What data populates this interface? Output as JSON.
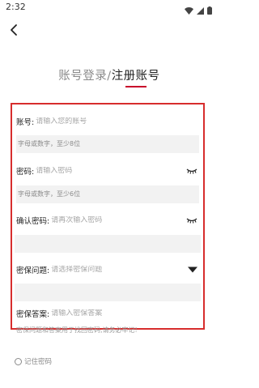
{
  "status": {
    "time": "2:32"
  },
  "nav": {
    "back_icon": "back-arrow-icon"
  },
  "tabs": {
    "login": "账号登录",
    "separator": "/",
    "register": "注册账号"
  },
  "form": {
    "account": {
      "label": "账号:",
      "placeholder": "请输入您的账号",
      "value": "",
      "hint": "字母或数字，至少8位"
    },
    "password": {
      "label": "密码:",
      "placeholder": "请输入密码",
      "value": "",
      "hint": "字母或数字，至少6位",
      "icon": "eye-closed-icon"
    },
    "confirm_password": {
      "label": "确认密码:",
      "placeholder": "请再次输入密码",
      "value": "",
      "icon": "eye-closed-icon"
    },
    "security_question": {
      "label": "密保问题:",
      "placeholder": "请选择密保问题",
      "icon": "dropdown-triangle-icon"
    },
    "security_answer": {
      "label": "密保答案:",
      "placeholder": "请输入密保答案",
      "value": ""
    }
  },
  "note": "密保问题和答案用于找回密码,请务必牢记!",
  "remember_password": {
    "label": "记住密码",
    "checked": false
  },
  "colors": {
    "accent": "#c8002a",
    "highlight_border": "#d72d2d",
    "field_bg": "#f2f2f2",
    "placeholder": "#a6a6a6"
  }
}
